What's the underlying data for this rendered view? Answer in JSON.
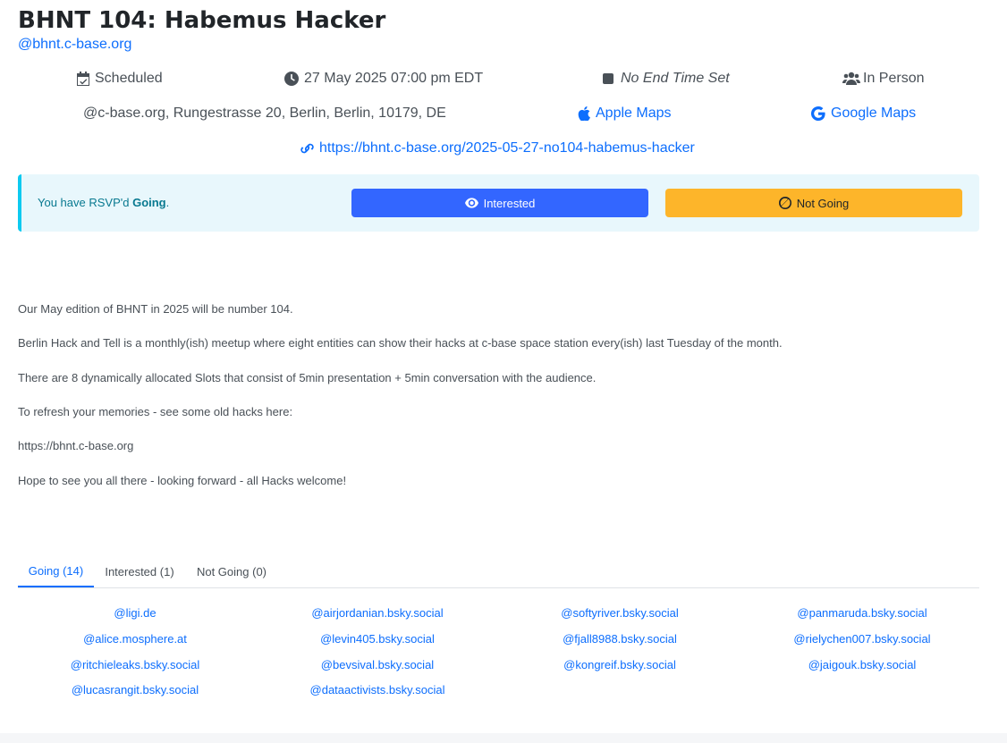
{
  "event": {
    "title": "BHNT 104: Habemus Hacker",
    "handle": "@bhnt.c-base.org",
    "status": "Scheduled",
    "start": "27 May 2025 07:00 pm EDT",
    "end": "No End Time Set",
    "mode": "In Person",
    "address": "@c-base.org, Rungestrasse 20, Berlin, Berlin, 10179, DE",
    "apple_maps": "Apple Maps",
    "google_maps": "Google Maps",
    "url": "https://bhnt.c-base.org/2025-05-27-no104-habemus-hacker"
  },
  "rsvp": {
    "prefix": "You have RSVP'd ",
    "state": "Going",
    "suffix": ".",
    "interested_label": "Interested",
    "not_going_label": "Not Going"
  },
  "description": [
    "Our May edition of BHNT in 2025 will be number 104.",
    "Berlin Hack and Tell is a monthly(ish) meetup where eight entities can show their hacks at c-base space station every(ish) last Tuesday of the month.",
    "There are 8 dynamically allocated Slots that consist of 5min presentation + 5min conversation with the audience.",
    "To refresh your memories - see some old hacks here:",
    "https://bhnt.c-base.org",
    "Hope to see you all there - looking forward - all Hacks welcome!"
  ],
  "tabs": [
    {
      "label": "Going (14)"
    },
    {
      "label": "Interested (1)"
    },
    {
      "label": "Not Going (0)"
    }
  ],
  "attendees": [
    "@ligi.de",
    "@airjordanian.bsky.social",
    "@softyriver.bsky.social",
    "@panmaruda.bsky.social",
    "@alice.mosphere.at",
    "@levin405.bsky.social",
    "@fjall8988.bsky.social",
    "@rielychen007.bsky.social",
    "@ritchieleaks.bsky.social",
    "@bevsival.bsky.social",
    "@kongreif.bsky.social",
    "@jaigouk.bsky.social",
    "@lucasrangit.bsky.social",
    "@dataactivists.bsky.social"
  ],
  "colors": {
    "link": "#0d6efd",
    "interested_button": "#3366ff",
    "not_going_button": "#fdb52a",
    "rsvp_bg": "#e8f7fc",
    "rsvp_border": "#0dcaf0"
  },
  "icons": {
    "status": "calendar-check-icon",
    "start": "clock-icon",
    "end": "stop-square-icon",
    "mode": "users-icon",
    "apple": "apple-icon",
    "google": "google-icon",
    "url": "link-icon",
    "interested": "eye-icon",
    "not_going": "ban-icon"
  }
}
